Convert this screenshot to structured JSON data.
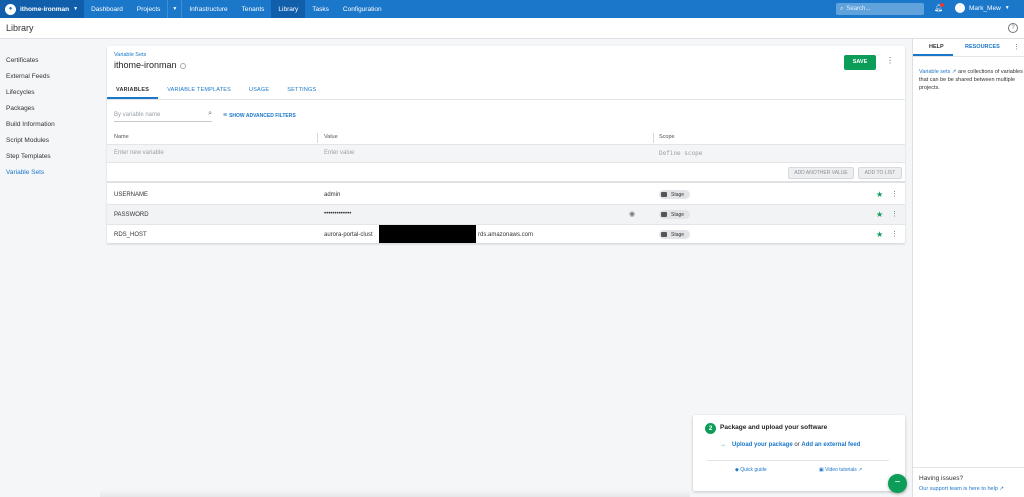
{
  "topnav": {
    "space_name": "ithome-ironman",
    "items": [
      {
        "label": "Dashboard"
      },
      {
        "label": "Projects"
      },
      {
        "label": "Infrastructure"
      },
      {
        "label": "Tenants"
      },
      {
        "label": "Library"
      },
      {
        "label": "Tasks"
      },
      {
        "label": "Configuration"
      }
    ],
    "active": "Library",
    "search_placeholder": "Search...",
    "user_name": "Mark_Mew",
    "accent_color": "#1a77ca"
  },
  "page": {
    "title": "Library"
  },
  "sidebar": {
    "items": [
      {
        "label": "Certificates"
      },
      {
        "label": "External Feeds"
      },
      {
        "label": "Lifecycles"
      },
      {
        "label": "Packages"
      },
      {
        "label": "Build Information"
      },
      {
        "label": "Script Modules"
      },
      {
        "label": "Step Templates"
      },
      {
        "label": "Variable Sets"
      }
    ],
    "active": "Variable Sets"
  },
  "main": {
    "breadcrumb": "Variable Sets",
    "title": "ithome-ironman",
    "save_label": "SAVE",
    "tabs": [
      {
        "label": "VARIABLES"
      },
      {
        "label": "VARIABLE TEMPLATES"
      },
      {
        "label": "USAGE"
      },
      {
        "label": "SETTINGS"
      }
    ],
    "active_tab": "VARIABLES",
    "filter_placeholder": "By variable name",
    "advanced_filters_label": "SHOW ADVANCED FILTERS",
    "columns": {
      "name": "Name",
      "value": "Value",
      "scope": "Scope"
    },
    "new_row": {
      "name_placeholder": "Enter new variable",
      "value_placeholder": "Enter value",
      "scope_placeholder": "Define scope"
    },
    "add_another_value_label": "ADD ANOTHER VALUE",
    "add_to_list_label": "ADD TO LIST",
    "variables": [
      {
        "name": "USERNAME",
        "value": "admin",
        "scope": "Stage"
      },
      {
        "name": "PASSWORD",
        "value": "•••••••••••••",
        "scope": "Stage"
      },
      {
        "name": "RDS_HOST",
        "value_prefix": "aurora-portal-clust",
        "value_suffix": "rds.amazonaws.com",
        "scope": "Stage"
      }
    ]
  },
  "help_panel": {
    "tabs": [
      {
        "label": "HELP"
      },
      {
        "label": "RESOURCES"
      }
    ],
    "description_link": "Variable sets",
    "description_rest": " are collections of variables that can be be shared between multiple projects.",
    "issues_title": "Having issues?",
    "support_link": "Our support team is here to help"
  },
  "onboarding": {
    "step": "2",
    "title": "Package and upload your software",
    "link1": "Upload your package",
    "or_text": " or ",
    "link2": "Add an external feed",
    "quick_guide": "Quick guide",
    "video_tutorials": "Video tutorials",
    "fab_icon": "minus-icon"
  }
}
